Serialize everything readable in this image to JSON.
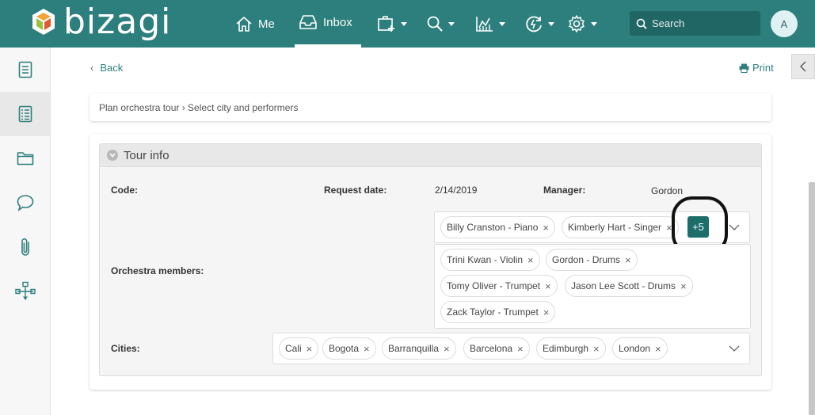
{
  "brand": {
    "name": "bizagi"
  },
  "topnav": {
    "me_label": "Me",
    "inbox_label": "Inbox",
    "search_placeholder": "Search",
    "avatar_initial": "A",
    "icons": [
      "home-icon",
      "inbox-icon",
      "new-case-icon",
      "search-icon",
      "analytics-icon",
      "activity-icon",
      "settings-icon"
    ]
  },
  "sidebar": {
    "icons": [
      "form-icon",
      "checklist-icon",
      "folder-icon",
      "comment-icon",
      "attachment-icon",
      "process-map-icon"
    ]
  },
  "page": {
    "back_label": "Back",
    "print_label": "Print",
    "breadcrumb": "Plan orchestra tour › Select city and performers"
  },
  "form": {
    "group_title": "Tour info",
    "code_label": "Code:",
    "code_value": "",
    "request_date_label": "Request date:",
    "request_date_value": "2/14/2019",
    "manager_label": "Manager:",
    "manager_value": "Gordon",
    "members_label": "Orchestra members:",
    "members_visible": [
      "Billy Cranston - Piano",
      "Kimberly Hart - Singer"
    ],
    "members_more": "+5",
    "members_overflow": [
      "Trini Kwan - Violin",
      "Gordon - Drums",
      "Tomy Oliver - Trumpet",
      "Jason Lee Scott - Drums",
      "Zack Taylor - Trumpet"
    ],
    "cities_label": "Cities:",
    "cities": [
      "Cali",
      "Bogota",
      "Barranquilla",
      "Barcelona",
      "Edimburgh",
      "London"
    ],
    "remove_glyph": "×"
  },
  "colors": {
    "topbar": "#2d7f7d",
    "accent": "#1d6e6b",
    "sidebar_bg": "#f7f7f7"
  }
}
